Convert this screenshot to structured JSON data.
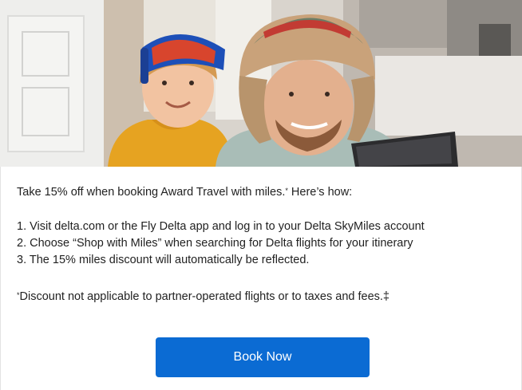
{
  "hero": {
    "image_label": "child in ski goggles and man in trapper hat looking at a tablet"
  },
  "intro": {
    "text": "Take 15% off when booking Award Travel with miles.",
    "mark": "*",
    "suffix": " Here’s how:"
  },
  "steps": [
    {
      "num": "1.",
      "text": "Visit delta.com or the Fly Delta app and log in to your Delta SkyMiles account"
    },
    {
      "num": "2.",
      "text": "Choose “Shop with Miles” when searching for Delta flights for your itinerary"
    },
    {
      "num": "3.",
      "text": "The 15% miles discount will automatically be reflected."
    }
  ],
  "disclaimer": {
    "mark": "*",
    "text": "Discount not applicable to partner-operated flights or to taxes and fees.‡"
  },
  "cta": {
    "label": "Book Now"
  },
  "colors": {
    "cta_background": "#0b6bd3",
    "cta_text": "#ffffff",
    "body_text": "#222222"
  }
}
